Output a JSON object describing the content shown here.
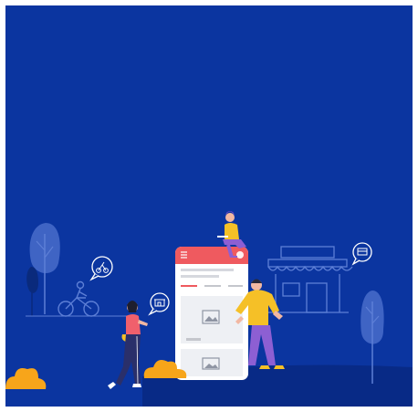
{
  "palette": {
    "background": "#0b35a0",
    "ground": "#082a86",
    "line_art": "#5d7fd6",
    "tree": "#3f64c4",
    "phone_body": "#ffffff",
    "app_header": "#ef5a5f",
    "shrub": "#f7a51a",
    "person_yellow": "#f5c027",
    "person_purple": "#8d5fd3",
    "person_pink": "#f0606c"
  },
  "icons": {
    "menu": "hamburger-menu-icon",
    "image_placeholder": "image-placeholder-icon",
    "bubble_cycle": "cycling-icon",
    "bubble_store": "shop-icon",
    "bubble_card": "card-icon"
  }
}
